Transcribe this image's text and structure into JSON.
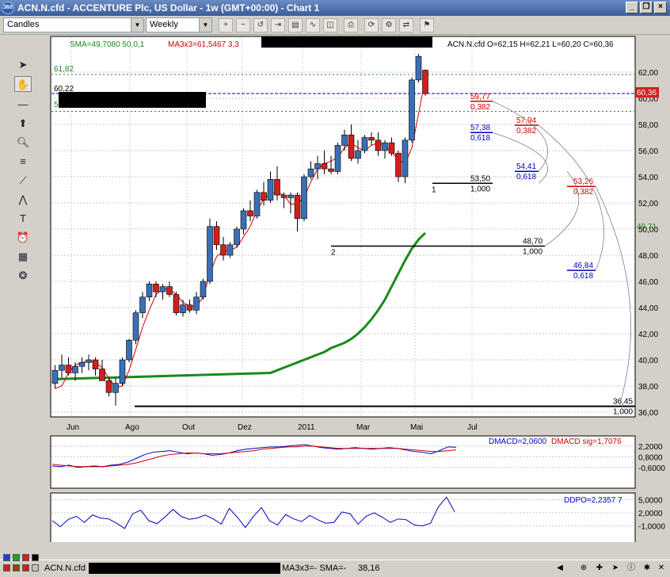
{
  "window": {
    "title": "ACN.N.cfd - ACCENTURE Plc, US Dollar - 1w (GMT+00:00) - Chart 1",
    "app_icon_text": "360"
  },
  "toolbar": {
    "chart_type": "Candles",
    "timeframe": "Weekly"
  },
  "indicators": {
    "sma_label": "SMA=49,7080  50,0,1",
    "ma_label": "MA3x3=61,5467  3,3",
    "ohlc_label": "ACN.N.cfd O=62,15 H=62,21 L=60,20 C=60,36",
    "current_price_tag": "60,36",
    "sma_price_tag": "49,71",
    "left_level_1": "61,82",
    "left_level_2": "60,22",
    "left_level_3": "5"
  },
  "fib": [
    {
      "value": "59,77",
      "ratio": "0,382",
      "color": "#d00000"
    },
    {
      "value": "57,94",
      "ratio": "0,382",
      "color": "#d00000"
    },
    {
      "value": "57,38",
      "ratio": "0,618",
      "color": "#0000c0"
    },
    {
      "value": "54,41",
      "ratio": "0,618",
      "color": "#0000c0"
    },
    {
      "value": "53,26",
      "ratio": "0,382",
      "color": "#d00000"
    },
    {
      "value": "53,50",
      "ratio": "1,000",
      "color": "#000000"
    },
    {
      "value": "48,70",
      "ratio": "1,000",
      "color": "#000000"
    },
    {
      "value": "46,84",
      "ratio": "0,618",
      "color": "#0000c0"
    },
    {
      "value": "36,45",
      "ratio": "1,000",
      "color": "#000000"
    }
  ],
  "pivots": [
    "1",
    "2"
  ],
  "y_axis": [
    "62,00",
    "60,00",
    "58,00",
    "56,00",
    "54,00",
    "52,00",
    "50,00",
    "48,00",
    "46,00",
    "44,00",
    "42,00",
    "40,00",
    "38,00",
    "36,00"
  ],
  "x_axis": [
    "Jun",
    "Ago",
    "Out",
    "Dez",
    "2011",
    "Mar",
    "Mai",
    "Jul"
  ],
  "macd": {
    "label_macd": "DMACD=2,0600",
    "label_sig": "DMACD sig=1,7076",
    "y_axis": [
      "2,2000",
      "0,8000",
      "-0,6000"
    ]
  },
  "dpo": {
    "label": "DDPO=2,2357  7",
    "y_axis": [
      "5,0000",
      "2,0000",
      "-1,0000"
    ]
  },
  "status": {
    "symbol": "ACN.N.cfd",
    "values": "MA3x3=-  SMA=-",
    "number": "38,16"
  },
  "colors": {
    "bull": "#3a6fb5",
    "bear": "#d21e1e",
    "sma": "#1a8a1a",
    "ma": "#d00000"
  },
  "candles": [
    [
      38.2,
      39.6,
      37.8,
      39.2
    ],
    [
      39.2,
      40.4,
      38.6,
      39.6
    ],
    [
      39.6,
      40.2,
      38.8,
      39.0
    ],
    [
      39.0,
      39.8,
      38.4,
      39.5
    ],
    [
      39.5,
      40.2,
      39.0,
      39.8
    ],
    [
      39.8,
      40.4,
      39.2,
      40.0
    ],
    [
      40.0,
      40.2,
      38.8,
      39.3
    ],
    [
      39.3,
      40.0,
      38.5,
      38.4
    ],
    [
      38.4,
      38.6,
      37.2,
      37.5
    ],
    [
      37.5,
      38.6,
      36.5,
      38.2
    ],
    [
      38.2,
      40.2,
      38.0,
      40.0
    ],
    [
      40.0,
      41.6,
      39.8,
      41.5
    ],
    [
      41.5,
      43.8,
      41.2,
      43.6
    ],
    [
      43.6,
      45.2,
      43.2,
      44.8
    ],
    [
      44.8,
      46.0,
      44.5,
      45.8
    ],
    [
      45.8,
      46.0,
      44.8,
      45.2
    ],
    [
      45.2,
      45.8,
      44.6,
      45.6
    ],
    [
      45.6,
      46.0,
      44.8,
      45.0
    ],
    [
      45.0,
      45.2,
      43.4,
      43.6
    ],
    [
      43.6,
      44.6,
      43.3,
      44.2
    ],
    [
      44.2,
      44.6,
      43.6,
      43.8
    ],
    [
      43.8,
      45.2,
      43.5,
      44.8
    ],
    [
      44.8,
      46.2,
      44.6,
      46.0
    ],
    [
      46.0,
      50.8,
      45.8,
      50.2
    ],
    [
      50.2,
      50.6,
      48.4,
      48.8
    ],
    [
      48.8,
      49.4,
      47.6,
      48.0
    ],
    [
      48.0,
      49.0,
      47.8,
      48.8
    ],
    [
      48.8,
      50.2,
      48.6,
      50.0
    ],
    [
      50.0,
      51.6,
      49.6,
      51.4
    ],
    [
      51.4,
      52.2,
      50.6,
      51.0
    ],
    [
      51.0,
      53.0,
      50.8,
      52.8
    ],
    [
      52.8,
      53.6,
      51.8,
      52.2
    ],
    [
      52.2,
      54.4,
      52.0,
      53.8
    ],
    [
      53.8,
      54.8,
      52.2,
      52.6
    ],
    [
      52.6,
      52.8,
      51.6,
      52.4
    ],
    [
      52.4,
      52.8,
      51.2,
      52.6
    ],
    [
      52.6,
      52.8,
      49.8,
      50.8
    ],
    [
      50.8,
      54.2,
      50.6,
      54.0
    ],
    [
      54.0,
      55.2,
      53.8,
      54.6
    ],
    [
      54.6,
      55.6,
      53.8,
      55.0
    ],
    [
      55.0,
      56.0,
      54.2,
      54.6
    ],
    [
      54.6,
      55.6,
      54.2,
      54.4
    ],
    [
      54.4,
      56.6,
      54.2,
      56.4
    ],
    [
      56.4,
      57.6,
      56.0,
      57.2
    ],
    [
      57.2,
      58.0,
      55.2,
      55.4
    ],
    [
      55.4,
      56.8,
      55.0,
      56.0
    ],
    [
      56.0,
      57.2,
      55.8,
      57.0
    ],
    [
      57.0,
      57.4,
      56.4,
      56.8
    ],
    [
      56.8,
      57.4,
      55.6,
      56.0
    ],
    [
      56.0,
      56.8,
      55.4,
      56.6
    ],
    [
      56.6,
      57.0,
      55.6,
      55.8
    ],
    [
      55.8,
      56.0,
      53.6,
      54.0
    ],
    [
      54.0,
      57.0,
      53.5,
      56.8
    ],
    [
      56.8,
      61.6,
      56.6,
      61.4
    ],
    [
      61.4,
      63.4,
      61.2,
      63.2
    ],
    [
      62.15,
      62.21,
      60.2,
      60.36
    ]
  ],
  "sma_series": [
    39.0,
    39.2,
    39.4,
    39.6,
    39.8,
    40.0,
    40.2,
    40.4,
    40.6,
    40.9,
    41.1,
    41.3,
    41.6,
    42.0,
    42.5,
    43.1,
    43.8,
    44.6,
    45.6,
    46.6,
    47.6,
    48.5,
    49.2,
    49.7
  ],
  "ma_series": [
    37.8,
    38.0,
    39.0,
    39.6,
    39.8,
    39.9,
    39.8,
    39.4,
    38.6,
    37.9,
    38.0,
    39.2,
    40.8,
    42.5,
    43.8,
    45.0,
    45.4,
    45.4,
    45.0,
    44.4,
    44.1,
    44.1,
    44.8,
    46.6,
    47.9,
    48.3,
    48.4,
    48.6,
    49.4,
    50.2,
    51.4,
    52.3,
    52.7,
    52.8,
    52.6,
    51.9,
    51.9,
    52.4,
    53.6,
    54.6,
    55.0,
    55.2,
    55.5,
    56.2,
    56.6,
    56.2,
    56.0,
    56.4,
    56.6,
    56.4,
    55.9,
    55.3,
    55.0,
    56.2,
    58.8,
    61.55
  ],
  "macd_main": [
    -0.4,
    -0.5,
    -0.3,
    -0.6,
    -0.5,
    -0.4,
    -0.5,
    -0.3,
    -0.2,
    0.1,
    0.6,
    1.1,
    1.4,
    1.5,
    1.6,
    1.4,
    1.2,
    1.3,
    1.2,
    1.0,
    1.1,
    1.3,
    1.6,
    1.8,
    1.9,
    2.0,
    2.1,
    2.1,
    2.2,
    2.3,
    2.4,
    2.2,
    2.0,
    1.9,
    1.8,
    1.9,
    2.0,
    1.9,
    1.8,
    1.9,
    2.0,
    1.9,
    1.7,
    1.5,
    1.4,
    1.2,
    1.6,
    2.1,
    2.06
  ],
  "macd_sig": [
    -0.2,
    -0.3,
    -0.4,
    -0.5,
    -0.5,
    -0.5,
    -0.5,
    -0.4,
    -0.3,
    -0.2,
    0.0,
    0.3,
    0.6,
    0.9,
    1.1,
    1.2,
    1.3,
    1.3,
    1.2,
    1.2,
    1.2,
    1.3,
    1.4,
    1.5,
    1.6,
    1.8,
    1.9,
    2.0,
    2.1,
    2.1,
    2.2,
    2.2,
    2.1,
    2.0,
    1.9,
    1.9,
    1.9,
    1.9,
    1.9,
    1.9,
    1.9,
    1.9,
    1.8,
    1.7,
    1.6,
    1.5,
    1.5,
    1.6,
    1.71
  ],
  "dpo_series": [
    0.2,
    -1.2,
    0.5,
    1.2,
    -0.2,
    1.5,
    0.8,
    0.6,
    -0.4,
    -1.6,
    1.8,
    2.6,
    0.2,
    -0.5,
    1.0,
    2.8,
    1.2,
    0.5,
    0.8,
    1.5,
    0.6,
    -0.6,
    3.0,
    1.0,
    -1.4,
    1.2,
    3.2,
    0.2,
    -0.8,
    1.6,
    0.6,
    0.0,
    1.4,
    0.4,
    -0.4,
    -0.2,
    2.2,
    1.8,
    -0.6,
    1.2,
    2.0,
    1.0,
    -0.2,
    0.6,
    0.4,
    -0.8,
    -1.0,
    -0.4,
    3.4,
    5.6,
    2.24
  ]
}
